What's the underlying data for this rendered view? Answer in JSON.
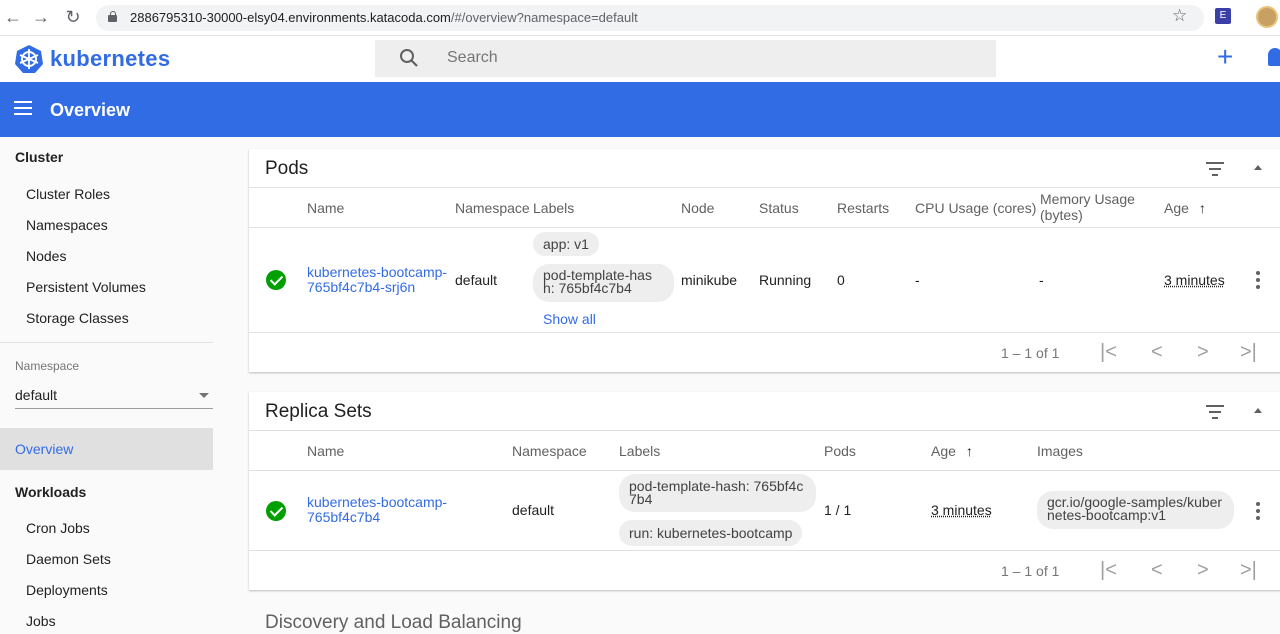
{
  "browser": {
    "url_host": "2886795310-30000-elsy04.environments.katacoda.com",
    "url_path": "/#/overview?namespace=default"
  },
  "app": {
    "brand": "kubernetes",
    "search_placeholder": "Search",
    "page_title": "Overview"
  },
  "sidebar": {
    "cluster_title": "Cluster",
    "cluster_items": [
      "Cluster Roles",
      "Namespaces",
      "Nodes",
      "Persistent Volumes",
      "Storage Classes"
    ],
    "namespace_label": "Namespace",
    "namespace_value": "default",
    "overview": "Overview",
    "workloads_title": "Workloads",
    "workload_items": [
      "Cron Jobs",
      "Daemon Sets",
      "Deployments",
      "Jobs"
    ]
  },
  "pods": {
    "title": "Pods",
    "headers": [
      "Name",
      "Namespace",
      "Labels",
      "Node",
      "Status",
      "Restarts",
      "CPU Usage (cores)",
      "Memory Usage (bytes)",
      "Age"
    ],
    "row": {
      "name_1": "kubernetes-bootcamp-",
      "name_2": "765bf4c7b4-srj6n",
      "namespace": "default",
      "label_1": "app: v1",
      "label_2a": "pod-template-has",
      "label_2b": "h: 765bf4c7b4",
      "show_all": "Show all",
      "node": "minikube",
      "status": "Running",
      "restarts": "0",
      "cpu": "-",
      "memory": "-",
      "age": "3 minutes"
    },
    "pagination": "1 – 1 of 1"
  },
  "replica_sets": {
    "title": "Replica Sets",
    "headers": [
      "Name",
      "Namespace",
      "Labels",
      "Pods",
      "Age",
      "Images"
    ],
    "row": {
      "name_1": "kubernetes-bootcamp-",
      "name_2": "765bf4c7b4",
      "namespace": "default",
      "label_1a": "pod-template-hash: 765bf4c",
      "label_1b": "7b4",
      "label_2": "run: kubernetes-bootcamp",
      "pods": "1 / 1",
      "age": "3 minutes",
      "image_1": "gcr.io/google-samples/kuber",
      "image_2": "netes-bootcamp:v1"
    },
    "pagination": "1 – 1 of 1"
  },
  "next_section": "Discovery and Load Balancing",
  "colors": {
    "accent": "#326ce5",
    "success": "#00a000"
  },
  "icons": {
    "sort": "↑",
    "first": "|<",
    "prev": "<",
    "next": ">",
    "last": ">|"
  }
}
